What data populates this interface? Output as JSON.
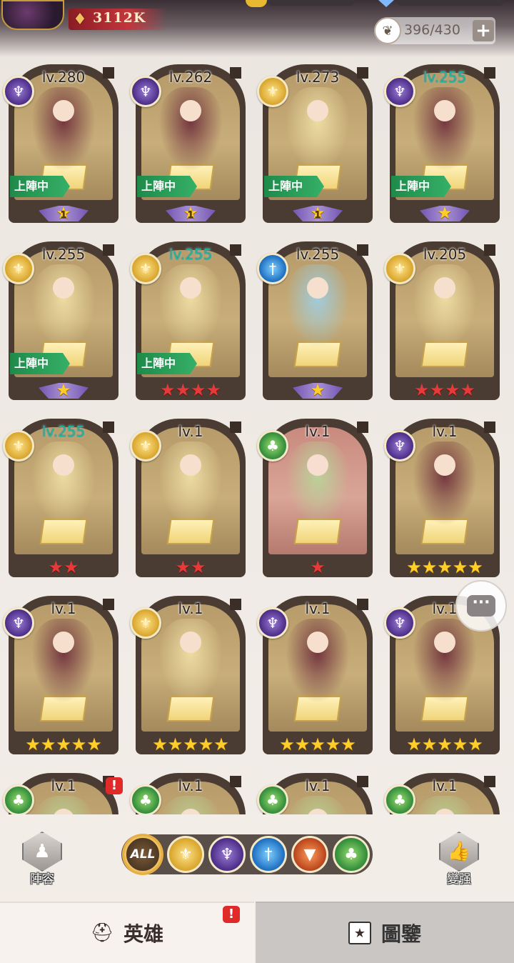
{
  "header": {
    "power_value": "3112K",
    "capacity_text": "396/430",
    "add_label": "+"
  },
  "heroes": [
    {
      "level": "lv.280",
      "class": "dark",
      "deployed": true,
      "deploy_label": "上陣中",
      "star_type": "gold-badge",
      "star_count": 1,
      "star_badge": "1",
      "bg": "gold",
      "max": false
    },
    {
      "level": "lv.262",
      "class": "dark",
      "deployed": true,
      "deploy_label": "上陣中",
      "star_type": "gold-badge",
      "star_count": 1,
      "star_badge": "1",
      "bg": "gold",
      "max": false
    },
    {
      "level": "lv.273",
      "class": "light",
      "deployed": true,
      "deploy_label": "上陣中",
      "star_type": "gold-badge",
      "star_count": 1,
      "star_badge": "1",
      "bg": "gold",
      "max": false
    },
    {
      "level": "lv.255",
      "class": "dark",
      "deployed": true,
      "deploy_label": "上陣中",
      "star_type": "gold-wing",
      "star_count": 1,
      "star_badge": "",
      "bg": "gold",
      "max": true
    },
    {
      "level": "lv.255",
      "class": "light",
      "deployed": true,
      "deploy_label": "上陣中",
      "star_type": "gold-wing",
      "star_count": 1,
      "star_badge": "",
      "bg": "gold",
      "max": false
    },
    {
      "level": "lv.255",
      "class": "light",
      "deployed": true,
      "deploy_label": "上陣中",
      "star_type": "red",
      "star_count": 4,
      "star_badge": "",
      "bg": "gold",
      "max": true
    },
    {
      "level": "lv.255",
      "class": "water",
      "deployed": false,
      "deploy_label": "",
      "star_type": "gold-wing",
      "star_count": 1,
      "star_badge": "",
      "bg": "gold",
      "max": false
    },
    {
      "level": "lv.205",
      "class": "light",
      "deployed": false,
      "deploy_label": "",
      "star_type": "red",
      "star_count": 4,
      "star_badge": "",
      "bg": "gold",
      "max": false
    },
    {
      "level": "lv.255",
      "class": "light",
      "deployed": false,
      "deploy_label": "",
      "star_type": "red",
      "star_count": 2,
      "star_badge": "",
      "bg": "gold",
      "max": true
    },
    {
      "level": "lv.1",
      "class": "light",
      "deployed": false,
      "deploy_label": "",
      "star_type": "red",
      "star_count": 2,
      "star_badge": "",
      "bg": "gold",
      "max": false
    },
    {
      "level": "lv.1",
      "class": "nature",
      "deployed": false,
      "deploy_label": "",
      "star_type": "red",
      "star_count": 1,
      "star_badge": "",
      "bg": "red",
      "max": false
    },
    {
      "level": "lv.1",
      "class": "dark",
      "deployed": false,
      "deploy_label": "",
      "star_type": "gold",
      "star_count": 5,
      "star_badge": "",
      "bg": "gold",
      "max": false
    },
    {
      "level": "lv.1",
      "class": "dark",
      "deployed": false,
      "deploy_label": "",
      "star_type": "gold",
      "star_count": 5,
      "star_badge": "",
      "bg": "gold",
      "max": false
    },
    {
      "level": "lv.1",
      "class": "light",
      "deployed": false,
      "deploy_label": "",
      "star_type": "gold",
      "star_count": 5,
      "star_badge": "",
      "bg": "gold",
      "max": false
    },
    {
      "level": "lv.1",
      "class": "dark",
      "deployed": false,
      "deploy_label": "",
      "star_type": "gold",
      "star_count": 5,
      "star_badge": "",
      "bg": "gold",
      "max": false
    },
    {
      "level": "lv.1",
      "class": "dark",
      "deployed": false,
      "deploy_label": "",
      "star_type": "gold",
      "star_count": 5,
      "star_badge": "",
      "bg": "gold",
      "max": false
    },
    {
      "level": "lv.1",
      "class": "nature",
      "deployed": false,
      "deploy_label": "",
      "star_type": "none",
      "star_count": 0,
      "star_badge": "",
      "bg": "gold",
      "max": false,
      "notice": "!"
    },
    {
      "level": "lv.1",
      "class": "nature",
      "deployed": false,
      "deploy_label": "",
      "star_type": "none",
      "star_count": 0,
      "star_badge": "",
      "bg": "gold",
      "max": false
    },
    {
      "level": "lv.1",
      "class": "nature",
      "deployed": false,
      "deploy_label": "",
      "star_type": "none",
      "star_count": 0,
      "star_badge": "",
      "bg": "gold",
      "max": false
    },
    {
      "level": "lv.1",
      "class": "nature",
      "deployed": false,
      "deploy_label": "",
      "star_type": "none",
      "star_count": 0,
      "star_badge": "",
      "bg": "gold",
      "max": false
    }
  ],
  "filter_bar": {
    "lineup_label": "陣容",
    "all_label": "ALL",
    "strengthen_label": "變强",
    "filters": [
      "light",
      "dark",
      "water",
      "fire",
      "nature"
    ]
  },
  "tabs": {
    "heroes_label": "英雄",
    "heroes_notice": "!",
    "codex_label": "圖鑒"
  },
  "colors": {
    "deploy_green": "#2ea35a",
    "max_level": "#1fb8a0",
    "star_gold": "#ffce2a",
    "star_red": "#e63a3a",
    "power_red": "#c4343c"
  },
  "icons": {
    "light": "light-element-icon",
    "dark": "dark-element-icon",
    "water": "water-element-icon",
    "fire": "fire-element-icon",
    "nature": "nature-element-icon"
  }
}
